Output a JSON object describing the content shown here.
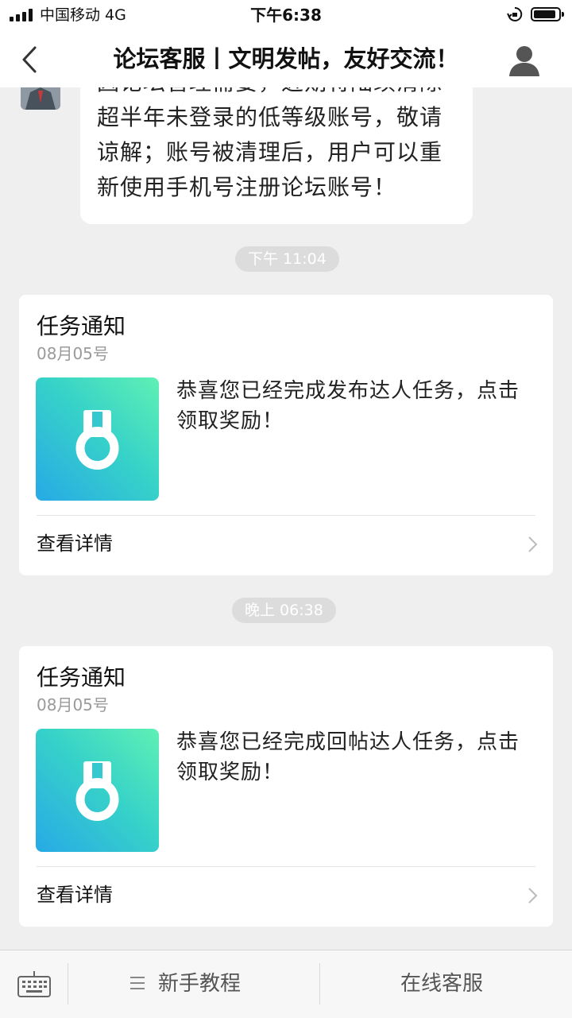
{
  "status_bar": {
    "carrier": "中国移动  4G",
    "time": "下午6:38"
  },
  "nav": {
    "title": "论坛客服丨文明发帖，友好交流！",
    "back_icon": "chevron-left-icon",
    "profile_icon": "user-silhouette-icon"
  },
  "messages": [
    {
      "type": "text",
      "text": "因论坛管理需要，近期将陆续清除超半年未登录的低等级账号，敬请谅解；账号被清理后，用户可以重新使用手机号注册论坛账号！"
    }
  ],
  "notices": [
    {
      "time": "下午 11:04",
      "title": "任务通知",
      "date": "08月05号",
      "icon": "medal-icon",
      "text": "恭喜您已经完成发布达人任务，点击领取奖励！",
      "link": "查看详情"
    },
    {
      "time": "晚上 06:38",
      "title": "任务通知",
      "date": "08月05号",
      "icon": "medal-icon",
      "text": "恭喜您已经完成回帖达人任务，点击领取奖励！",
      "link": "查看详情"
    }
  ],
  "bottom_bar": {
    "keyboard_icon": "keyboard-icon",
    "menu1": "新手教程",
    "menu2": "在线客服"
  },
  "colors": {
    "thumb_gradient": [
      "#5ff0b4",
      "#27a9e6"
    ],
    "background": "#efefef"
  }
}
